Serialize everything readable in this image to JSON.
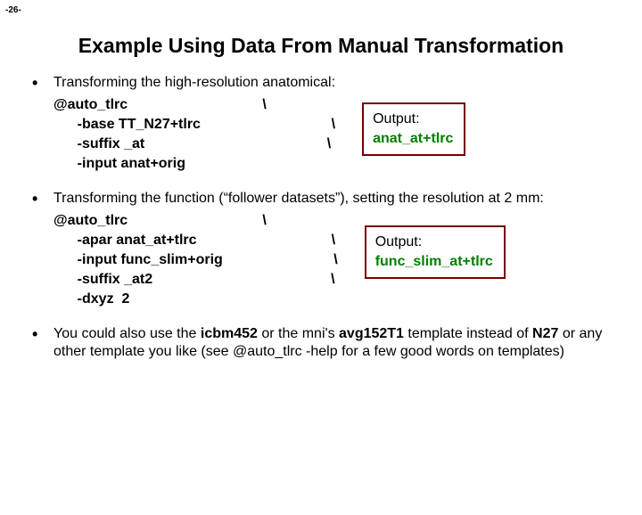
{
  "page_number": "-26-",
  "title": "Example Using Data From Manual Transformation",
  "bullet1": {
    "text": "Transforming the high-resolution anatomical:",
    "cmd": [
      "@auto_tlrc                                  \\",
      "      -base TT_N27+tlrc                                 \\",
      "      -suffix _at                                              \\",
      "      -input anat+orig"
    ],
    "output_label": "Output:",
    "output_value": "anat_at+tlrc"
  },
  "bullet2": {
    "text": "Transforming the function (“follower datasets”), setting the resolution at 2 mm:",
    "cmd": [
      "@auto_tlrc                                  \\",
      "      -apar anat_at+tlrc                                  \\",
      "      -input func_slim+orig                            \\",
      "      -suffix _at2                                             \\",
      "      -dxyz  2"
    ],
    "output_label": "Output:",
    "output_value": "func_slim_at+tlrc"
  },
  "bullet3": {
    "text_a": "You could also use the ",
    "text_b": "icbm452",
    "text_c": " or the mni's ",
    "text_d": "avg152T1",
    "text_e": " template instead of ",
    "text_f": "N27",
    "text_g": " or any other template you like (see @auto_tlrc -help for a few good words on templates)"
  }
}
